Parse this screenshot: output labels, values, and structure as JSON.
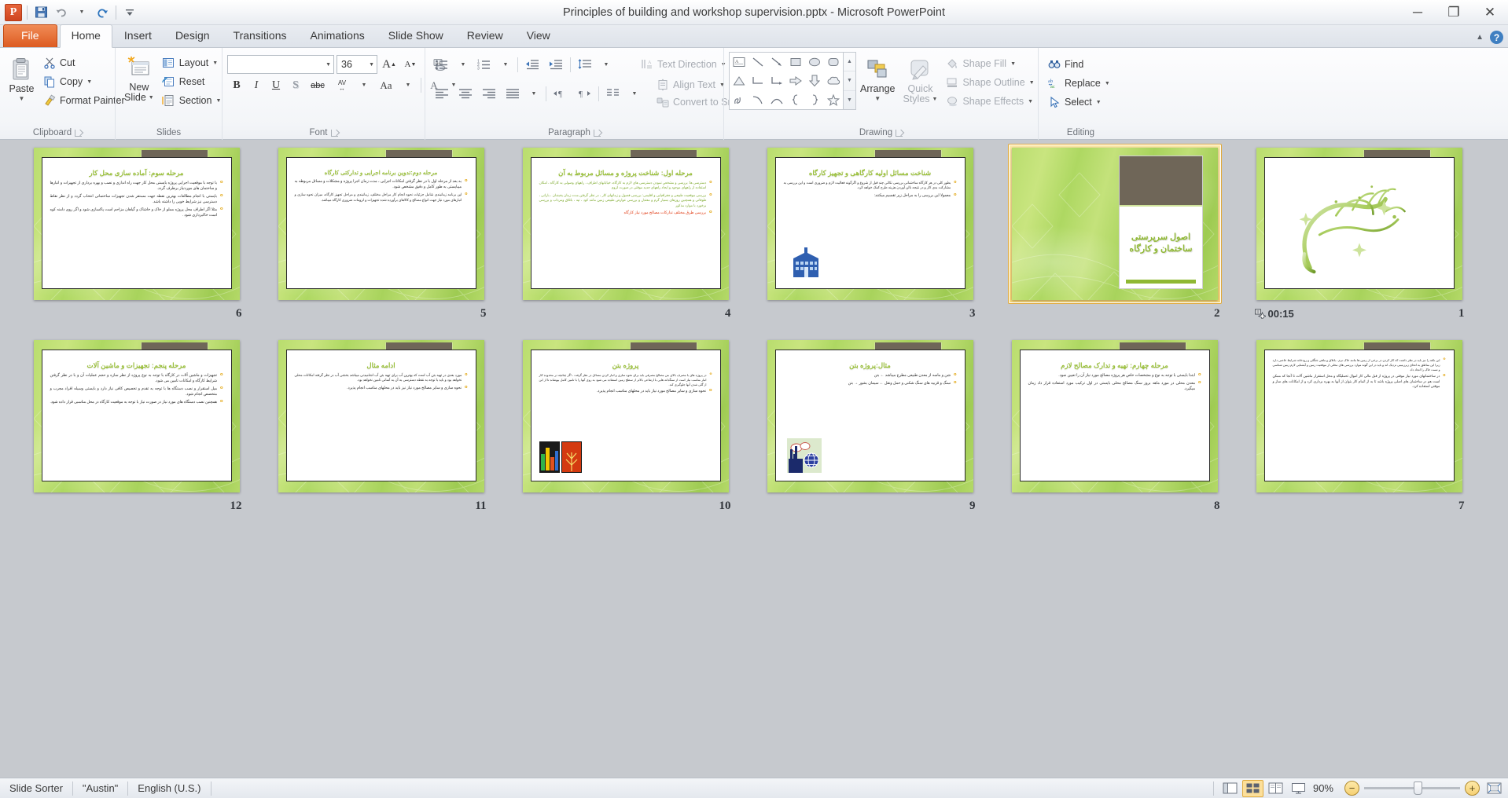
{
  "window": {
    "title": "Principles of building and workshop supervision.pptx  -  Microsoft PowerPoint",
    "app_logo": "P",
    "minimize": "─",
    "restore": "❐",
    "close": "✕"
  },
  "quick_access": [
    {
      "name": "save-icon",
      "label": "Save"
    },
    {
      "name": "undo-icon",
      "label": "Undo"
    },
    {
      "name": "redo-icon",
      "label": "Redo"
    },
    {
      "name": "customize-qat-icon",
      "label": "Customize Quick Access Toolbar"
    }
  ],
  "tabs": [
    {
      "label": "File",
      "kind": "file"
    },
    {
      "label": "Home",
      "kind": "active"
    },
    {
      "label": "Insert",
      "kind": "normal"
    },
    {
      "label": "Design",
      "kind": "normal"
    },
    {
      "label": "Transitions",
      "kind": "normal"
    },
    {
      "label": "Animations",
      "kind": "normal"
    },
    {
      "label": "Slide Show",
      "kind": "normal"
    },
    {
      "label": "Review",
      "kind": "normal"
    },
    {
      "label": "View",
      "kind": "normal"
    }
  ],
  "tab_right": {
    "minimize_ribbon": "▲",
    "help": "?"
  },
  "ribbon": {
    "clipboard": {
      "label": "Clipboard",
      "paste": "Paste",
      "cut": "Cut",
      "copy": "Copy",
      "format_painter": "Format Painter"
    },
    "slides": {
      "label": "Slides",
      "new_slide": "New\nSlide",
      "new_slide_line1": "New",
      "new_slide_line2": "Slide",
      "layout": "Layout",
      "reset": "Reset",
      "section": "Section"
    },
    "font": {
      "label": "Font",
      "font_name_value": "",
      "font_size_value": "36",
      "grow_font": "A",
      "shrink_font": "A",
      "clear_formatting": "Aa",
      "bold": "B",
      "italic": "I",
      "underline": "U",
      "shadow": "S",
      "strikethrough": "abc",
      "character_spacing": "AV",
      "change_case": "Aa",
      "font_color": "A"
    },
    "paragraph": {
      "label": "Paragraph",
      "text_direction": "Text Direction",
      "align_text": "Align Text",
      "convert_to_smartart": "Convert to SmartArt"
    },
    "drawing": {
      "label": "Drawing",
      "arrange": "Arrange",
      "quick_styles_line1": "Quick",
      "quick_styles_line2": "Styles",
      "shape_fill": "Shape Fill",
      "shape_outline": "Shape Outline",
      "shape_effects": "Shape Effects",
      "shapes": [
        "text-box-shape",
        "line-shape",
        "arrow-shape",
        "rectangle-shape",
        "oval-shape",
        "rounded-rectangle-shape",
        "triangle-shape",
        "elbow-connector-shape",
        "elbow-arrow-connector-shape",
        "right-arrow-shape",
        "down-arrow-shape",
        "cloud-shape",
        "scribble-shape",
        "curve-shape",
        "arc-shape",
        "left-brace-shape",
        "right-brace-shape",
        "star-shape"
      ]
    },
    "editing": {
      "label": "Editing",
      "find": "Find",
      "replace": "Replace",
      "select": "Select"
    }
  },
  "slides": [
    {
      "number": "6",
      "type": "content",
      "selected": false,
      "title": "مرحله سوم: آماده سازی محل کار",
      "bullets": [
        {
          "text": "با توجه با موقعیت اجرایی پروژه بایستی محل کار جهت راه اندازی و نصب و بهره برداری از تجهیزات و انبارها و ساختمان های موردنیاز برطرف گردد.",
          "color": "#2b2b2b"
        },
        {
          "text": "بایستی با انجام مطالعات بهترین نقطه جهت مستقر شدن تجهیزات ساختمانی انتخاب گردد و از نظر نقاط دسترسی نیز شرایط خوبی را داشته باشد.",
          "color": "#2b2b2b"
        },
        {
          "text": "مثلا اگر اطراف محل پروژه مملو از خاک و خاشاک و گیاهان مزاحم است پاکسازی شود و اگر روی دامنه کوه است خاکبرداری شود .",
          "color": "#2b2b2b"
        }
      ]
    },
    {
      "number": "5",
      "type": "content",
      "selected": false,
      "title": "مرحله دوم:تدوین برنامه اجرایی و تدارکتی کارگاه",
      "bullets": [
        {
          "text": "به بعد از مرحله اول با در نظر گرفتن امکانات اجرایی ، مدت زمان اجرا پروژه و مشکلات و مسائل مربوطه به میبایستی به طور کامل و دقیق مشخص شود.",
          "color": "#2b2b2b"
        },
        {
          "text": "این برنامه زمانبندی شامل جزئیات نحوه انجام کار مراحل مختلف، زمانبندی و مراحل تجهیز کارگاه، میزان نحوه سازی و انبارهای مورد نیاز جهت انواع مصالح و کالاهای برآورده شده تجهیزات و لزومات ضروری کارگاه میباشد.",
          "color": "#2b2b2b"
        }
      ]
    },
    {
      "number": "4",
      "type": "content",
      "selected": false,
      "title": "مرحله اول: شناخت پروژه و مسائل مربوط به آن",
      "bullets": [
        {
          "text": "دسترسی ها: بررسی و مشخص نمودن دسترسی های لازم به کارگاه، خیابانهای اطراف ، راههای وصولی به کارگاه ، امکان استفاده از راههای موجود و ایجاد راههای جدید موقتی در صورت لزوم",
          "color": "#7da92e"
        },
        {
          "text": "بررسی موقعیت طبیعی و جغرافیایی و اقلیمی: بررسی فصول و زمانهای کار ، در نظر گرفتن مدت زمان یخبندان ، بارانی ، طوفانی و همچنین روزهای بسیار گرم و معتدل و بررسی عوارض طبیعی زمین مانند کود ، تپه ، باتلاق ومرداب و بررسی برخورد با موارد مذکور",
          "color": "#7da92e"
        },
        {
          "text": "بررسی طرق مختلف تدارکات مصالح مورد نیاز کارگاه",
          "color": "#e03a12"
        }
      ]
    },
    {
      "number": "3",
      "type": "content",
      "selected": false,
      "title": "شناخت مسائل اولیه کارگاهی و تجهیز کارگاه",
      "bullets": [
        {
          "text": "بطور کلی در هر کارگاه ساختمانی بررسی نکاتی چند قبل از شروع و اگرگونه فعالیت لازم و ضروری است و این بررسی به مشارکت بدی کار و در نتیجه بالن آوردن هزینه طرح کمک خواهد کرد.",
          "color": "#2b2b2b"
        },
        {
          "text": "معمولا این بررسی را به مراحل زیر تقسیم میکنند:",
          "color": "#2b2b2b"
        }
      ],
      "has_building_clipart": true
    },
    {
      "number": "2",
      "type": "title",
      "selected": true,
      "title": "اصول سرپرستی\nساختمان و کارگاه",
      "title_line1": "اصول سرپرستی",
      "title_line2": "ساختمان و کارگاه"
    },
    {
      "number": "1",
      "type": "calligraphy",
      "selected": false,
      "timing": "00:15",
      "calligraphy": "بسم الله الرحمن الرحیم"
    },
    {
      "number": "12",
      "type": "content",
      "selected": false,
      "title": "مرحله پنجم: تجهیزات و ماشین آلات",
      "bullets": [
        {
          "text": "تجهیزات و ماشین آلات در کارگاه با توجه به نوع پروژه از نظر سازه و حجم عملیات آن و با در نظر گرفتن شرایط کارگاه و امکانات تامین می شود.",
          "color": "#2b2b2b"
        },
        {
          "text": "میل استقرار و نصب دستگاه ها با توجه به تقدم و تخصیص کافی نیاز دارد و بایستی وسیله افراد مجرب و متخصص انجام شود.",
          "color": "#2b2b2b"
        },
        {
          "text": "همچنین نصب دستگاه های مورد نیاز در صورت نیاز با توجه به موقعیت کارگاه در محل مناسبی قرار داده شود.",
          "color": "#2b2b2b"
        }
      ]
    },
    {
      "number": "11",
      "type": "content",
      "selected": false,
      "title": "ادامه مثال",
      "bullets": [
        {
          "text": "مورد بعدی در تهیه بتن آب است که بهترین آب برای تهیه بتن آب اشامیدنی میباشد بخشی آب در نظر گرفته امکانات محلی نخواهد بود و باید با توجه به نقطه دسترسی به آن به آسانی تامین نخواهد بود.",
          "color": "#2b2b2b"
        },
        {
          "text": "نحوه سازی و سایر مصالح مورد نیاز نیز باید در محلهای مناسب انجام پذیرد.",
          "color": "#2b2b2b"
        }
      ]
    },
    {
      "number": "10",
      "type": "content",
      "selected": false,
      "title": "پروژه بتن",
      "bullets": [
        {
          "text": "در پروژه های با مصرف بالای بتن مصالح مصرفی باید برای نحوه سازی و انبار کردن مسائل در نظر گرفت ، اگر چنانچه در محدوده کار انبار مناسب نیاز است از سنگدانه هایی با ارتفاعی بالاتر از سطح زمین استفاده می شود به روی آنها را با تامین کامل بپوشاند تا از این از گلی شدن آنها جلوگیری کند.",
          "color": "#2b2b2b"
        },
        {
          "text": "نحوه سازی و سایر مصالح مورد نیاز باید در محلهای مناسب انجام پذیرد.",
          "color": "#2b2b2b"
        }
      ],
      "has_chart_clipart": true
    },
    {
      "number": "9",
      "type": "content",
      "selected": false,
      "title": "مثال:پروژه بتن",
      "bullets": [
        {
          "text": "شن و ماسه از معدن طبیعی مطرح میباشد ← بتن",
          "color": "#2b2b2b"
        },
        {
          "text": "سنگ و قزبیه های سنگ شکنی و حمل ونقل ← سیمان بشور → بتن",
          "color": "#2b2b2b"
        }
      ],
      "has_factory_clipart": true
    },
    {
      "number": "8",
      "type": "content",
      "selected": false,
      "title": "مرحله چهارم: تهیه و تدارک مصالح لازم",
      "bullets": [
        {
          "text": "ابتدا بایستی با توجه به نوع و مشخصات خاص هر پروژه مصالح مورد نیاز آن را تعیین نمود.",
          "color": "#2b2b2b"
        },
        {
          "text": "معدن محلی در مورد ماهه بروز سنگ مصالح محلی بایستی در اول ترکیب مورد استفاده قرار داد زمان میگیرد.",
          "color": "#2b2b2b"
        }
      ]
    },
    {
      "number": "7",
      "type": "content",
      "selected": false,
      "title": "",
      "bullets": [
        {
          "text": "این نکته را نیز باید در نظر داشت که کار کردن در برخی از زمین ها مانند خاک نرم ، باتلاق و ماهی جنگلی و رودخانه شرایط خاصی دارد زیرا این مناطق به انحای زیرزمینی نزدیک اند و باید در این گونه موارد بررسی های محلی از موقعیت زمین و آبشنایی لازم زمین شناسی و تست خاک را انجاد داد.",
          "color": "#2b2b2b"
        },
        {
          "text": "در ساختمانهای مورد نیاز موقتی در پروژه از قبل مالی کار اموال تحملیگاه و محل استقرار ماشین آلات تا آنجا که ممکن است هم در ساختمان های اصلی پروژه باشد تا به از اتمام کار بتوان از آنها به بهره برداری کرد و از امکانات های ساز و موقتی استفاده کرد.",
          "color": "#2b2b2b"
        }
      ]
    }
  ],
  "statusbar": {
    "view_name": "Slide Sorter",
    "theme": "\"Austin\"",
    "language": "English (U.S.)",
    "zoom_percent": "90%",
    "zoom_out": "−",
    "zoom_in": "+",
    "views": [
      {
        "name": "view-normal",
        "active": false
      },
      {
        "name": "view-slide-sorter",
        "active": true
      },
      {
        "name": "view-reading",
        "active": false
      },
      {
        "name": "view-slide-show",
        "active": false
      }
    ],
    "fit_to_window": "fit-slide-to-window-icon"
  }
}
